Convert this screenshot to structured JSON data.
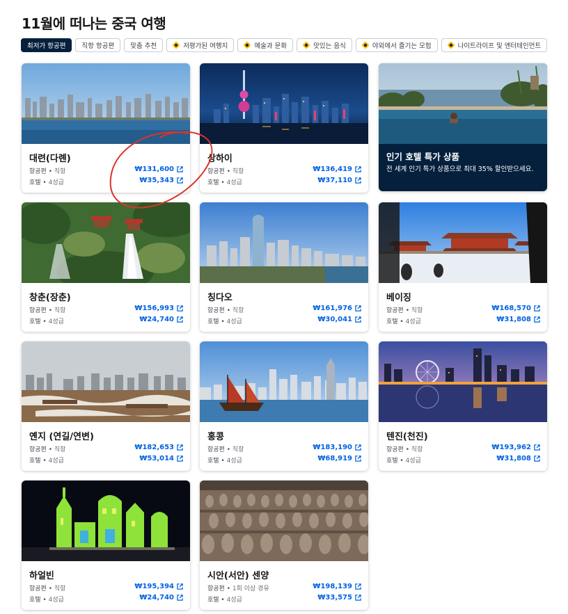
{
  "page": {
    "title": "11월에 떠나는 중국 여행"
  },
  "chips": [
    {
      "label": "최저가 항공편",
      "active": true,
      "icon": ""
    },
    {
      "label": "직항 항공편",
      "active": false,
      "icon": ""
    },
    {
      "label": "맞춤 추천",
      "active": false,
      "icon": ""
    },
    {
      "label": "저평가된 여행지",
      "active": false,
      "icon": "sparkle-icon"
    },
    {
      "label": "예술과 문화",
      "active": false,
      "icon": "sparkle-icon"
    },
    {
      "label": "맛있는 음식",
      "active": false,
      "icon": "sparkle-icon"
    },
    {
      "label": "야외에서 즐기는 모험",
      "active": false,
      "icon": "sparkle-icon"
    },
    {
      "label": "나이트라이프 및 엔터테인먼트",
      "active": false,
      "icon": "sparkle-icon"
    }
  ],
  "cards": [
    {
      "name": "대련(다롄)",
      "flight_label": "항공편",
      "flight_sub": "직항",
      "hotel_label": "호텔",
      "hotel_sub": "4성급",
      "flight_price": "₩131,600",
      "hotel_price": "₩35,343",
      "image": "dalian-skyline"
    },
    {
      "name": "상하이",
      "flight_label": "항공편",
      "flight_sub": "직항",
      "hotel_label": "호텔",
      "hotel_sub": "4성급",
      "flight_price": "₩136,419",
      "hotel_price": "₩37,110",
      "image": "shanghai-night"
    },
    {
      "name": "창춘(장춘)",
      "flight_label": "항공편",
      "flight_sub": "직항",
      "hotel_label": "호텔",
      "hotel_sub": "4성급",
      "flight_price": "₩156,993",
      "hotel_price": "₩24,740",
      "image": "changchun-waterfall"
    },
    {
      "name": "칭다오",
      "flight_label": "항공편",
      "flight_sub": "직항",
      "hotel_label": "호텔",
      "hotel_sub": "4성급",
      "flight_price": "₩161,976",
      "hotel_price": "₩30,041",
      "image": "qingdao-city"
    },
    {
      "name": "베이징",
      "flight_label": "항공편",
      "flight_sub": "직항",
      "hotel_label": "호텔",
      "hotel_sub": "4성급",
      "flight_price": "₩168,570",
      "hotel_price": "₩31,808",
      "image": "beijing-forbidden-city"
    },
    {
      "name": "옌지 (연길/연변)",
      "flight_label": "항공편",
      "flight_sub": "직항",
      "hotel_label": "호텔",
      "hotel_sub": "4성급",
      "flight_price": "₩182,653",
      "hotel_price": "₩53,014",
      "image": "yanji-winter"
    },
    {
      "name": "홍콩",
      "flight_label": "항공편",
      "flight_sub": "직항",
      "hotel_label": "호텔",
      "hotel_sub": "4성급",
      "flight_price": "₩183,190",
      "hotel_price": "₩68,919",
      "image": "hongkong-harbour"
    },
    {
      "name": "텐진(천진)",
      "flight_label": "항공편",
      "flight_sub": "직항",
      "hotel_label": "호텔",
      "hotel_sub": "4성급",
      "flight_price": "₩193,962",
      "hotel_price": "₩31,808",
      "image": "tianjin-eye"
    },
    {
      "name": "하얼빈",
      "flight_label": "항공편",
      "flight_sub": "직항",
      "hotel_label": "호텔",
      "hotel_sub": "4성급",
      "flight_price": "₩195,394",
      "hotel_price": "₩24,740",
      "image": "harbin-ice"
    },
    {
      "name": "시안(서안) 센양",
      "flight_label": "항공편",
      "flight_sub": "1회 이상 경유",
      "hotel_label": "호텔",
      "hotel_sub": "4성급",
      "flight_price": "₩198,139",
      "hotel_price": "₩33,575",
      "image": "xian-terracotta"
    }
  ],
  "promo": {
    "title": "인기 호텔 특가 상품",
    "description": "전 세계 인기 특가 상품으로 최대 35% 할인받으세요.",
    "image": "infinity-pool"
  },
  "colors": {
    "brand_navy": "#05203c",
    "price_blue": "#0062e3",
    "annotation_red": "#d9342b"
  }
}
